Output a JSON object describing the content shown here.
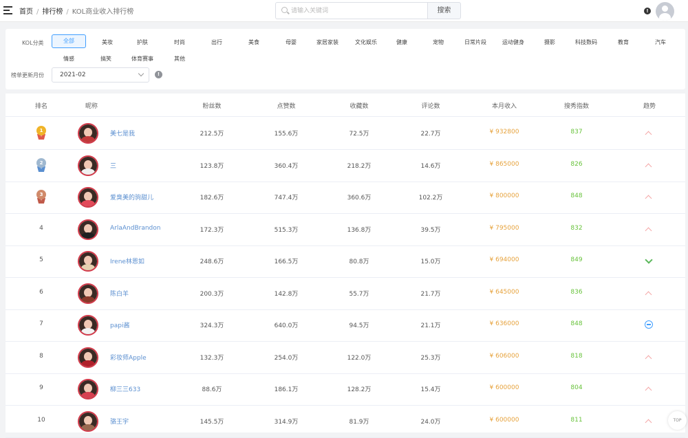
{
  "header": {
    "breadcrumb": [
      "首页",
      "排行榜",
      "KOL商业收入排行榜"
    ],
    "search_placeholder": "请输入关键词",
    "search_button": "搜索"
  },
  "filters": {
    "category_label": "KOL分类",
    "categories": [
      "全部",
      "美妆",
      "护肤",
      "时尚",
      "出行",
      "美食",
      "母婴",
      "家居家装",
      "文化娱乐",
      "健康",
      "宠物",
      "日常片段",
      "运动健身",
      "摄影",
      "科技数码",
      "教育",
      "汽车",
      "情感",
      "搞笑",
      "体育赛事",
      "其他"
    ],
    "active_category": "全部",
    "month_label": "榜单更新月份",
    "month_value": "2021-02"
  },
  "table": {
    "headers": [
      "排名",
      "昵称",
      "粉丝数",
      "点赞数",
      "收藏数",
      "评论数",
      "本月收入",
      "搜秀指数",
      "趋势"
    ],
    "rows": [
      {
        "rank": "1",
        "name": "美七是我",
        "fans": "212.5万",
        "likes": "155.6万",
        "favs": "72.5万",
        "comments": "22.7万",
        "income": "¥ 932800",
        "score": "837",
        "trend": "up"
      },
      {
        "rank": "2",
        "name": "三",
        "fans": "123.8万",
        "likes": "360.4万",
        "favs": "218.2万",
        "comments": "14.6万",
        "income": "¥ 865000",
        "score": "826",
        "trend": "up"
      },
      {
        "rank": "3",
        "name": "爱臭美的驹甜儿",
        "fans": "182.6万",
        "likes": "747.4万",
        "favs": "360.6万",
        "comments": "102.2万",
        "income": "¥ 800000",
        "score": "848",
        "trend": "up"
      },
      {
        "rank": "4",
        "name": "ArlaAndBrandon",
        "fans": "172.3万",
        "likes": "515.3万",
        "favs": "136.8万",
        "comments": "39.5万",
        "income": "¥ 795000",
        "score": "832",
        "trend": "up"
      },
      {
        "rank": "5",
        "name": "Irene林恩如",
        "fans": "248.6万",
        "likes": "166.5万",
        "favs": "80.8万",
        "comments": "15.0万",
        "income": "¥ 694000",
        "score": "849",
        "trend": "down"
      },
      {
        "rank": "6",
        "name": "陈白羊",
        "fans": "200.3万",
        "likes": "142.8万",
        "favs": "55.7万",
        "comments": "21.7万",
        "income": "¥ 645000",
        "score": "836",
        "trend": "up"
      },
      {
        "rank": "7",
        "name": "papi酱",
        "fans": "324.3万",
        "likes": "640.0万",
        "favs": "94.5万",
        "comments": "21.1万",
        "income": "¥ 636000",
        "score": "848",
        "trend": "flat"
      },
      {
        "rank": "8",
        "name": "彩妆师Apple",
        "fans": "132.3万",
        "likes": "254.0万",
        "favs": "122.0万",
        "comments": "25.3万",
        "income": "¥ 606000",
        "score": "818",
        "trend": "up"
      },
      {
        "rank": "9",
        "name": "柳三三633",
        "fans": "88.6万",
        "likes": "186.1万",
        "favs": "128.2万",
        "comments": "15.4万",
        "income": "¥ 600000",
        "score": "804",
        "trend": "up"
      },
      {
        "rank": "10",
        "name": "骆王宇",
        "fans": "145.5万",
        "likes": "314.9万",
        "favs": "81.9万",
        "comments": "24.0万",
        "income": "¥ 600000",
        "score": "811",
        "trend": "up"
      }
    ]
  },
  "back_to_top": "TOP",
  "colors": {
    "accent": "#409eff",
    "income": "#e6a23c",
    "score": "#67c23a",
    "name": "#5b8fd0",
    "gold": "#f0b429",
    "silver": "#9fb8d0",
    "bronze": "#d08a6a"
  }
}
